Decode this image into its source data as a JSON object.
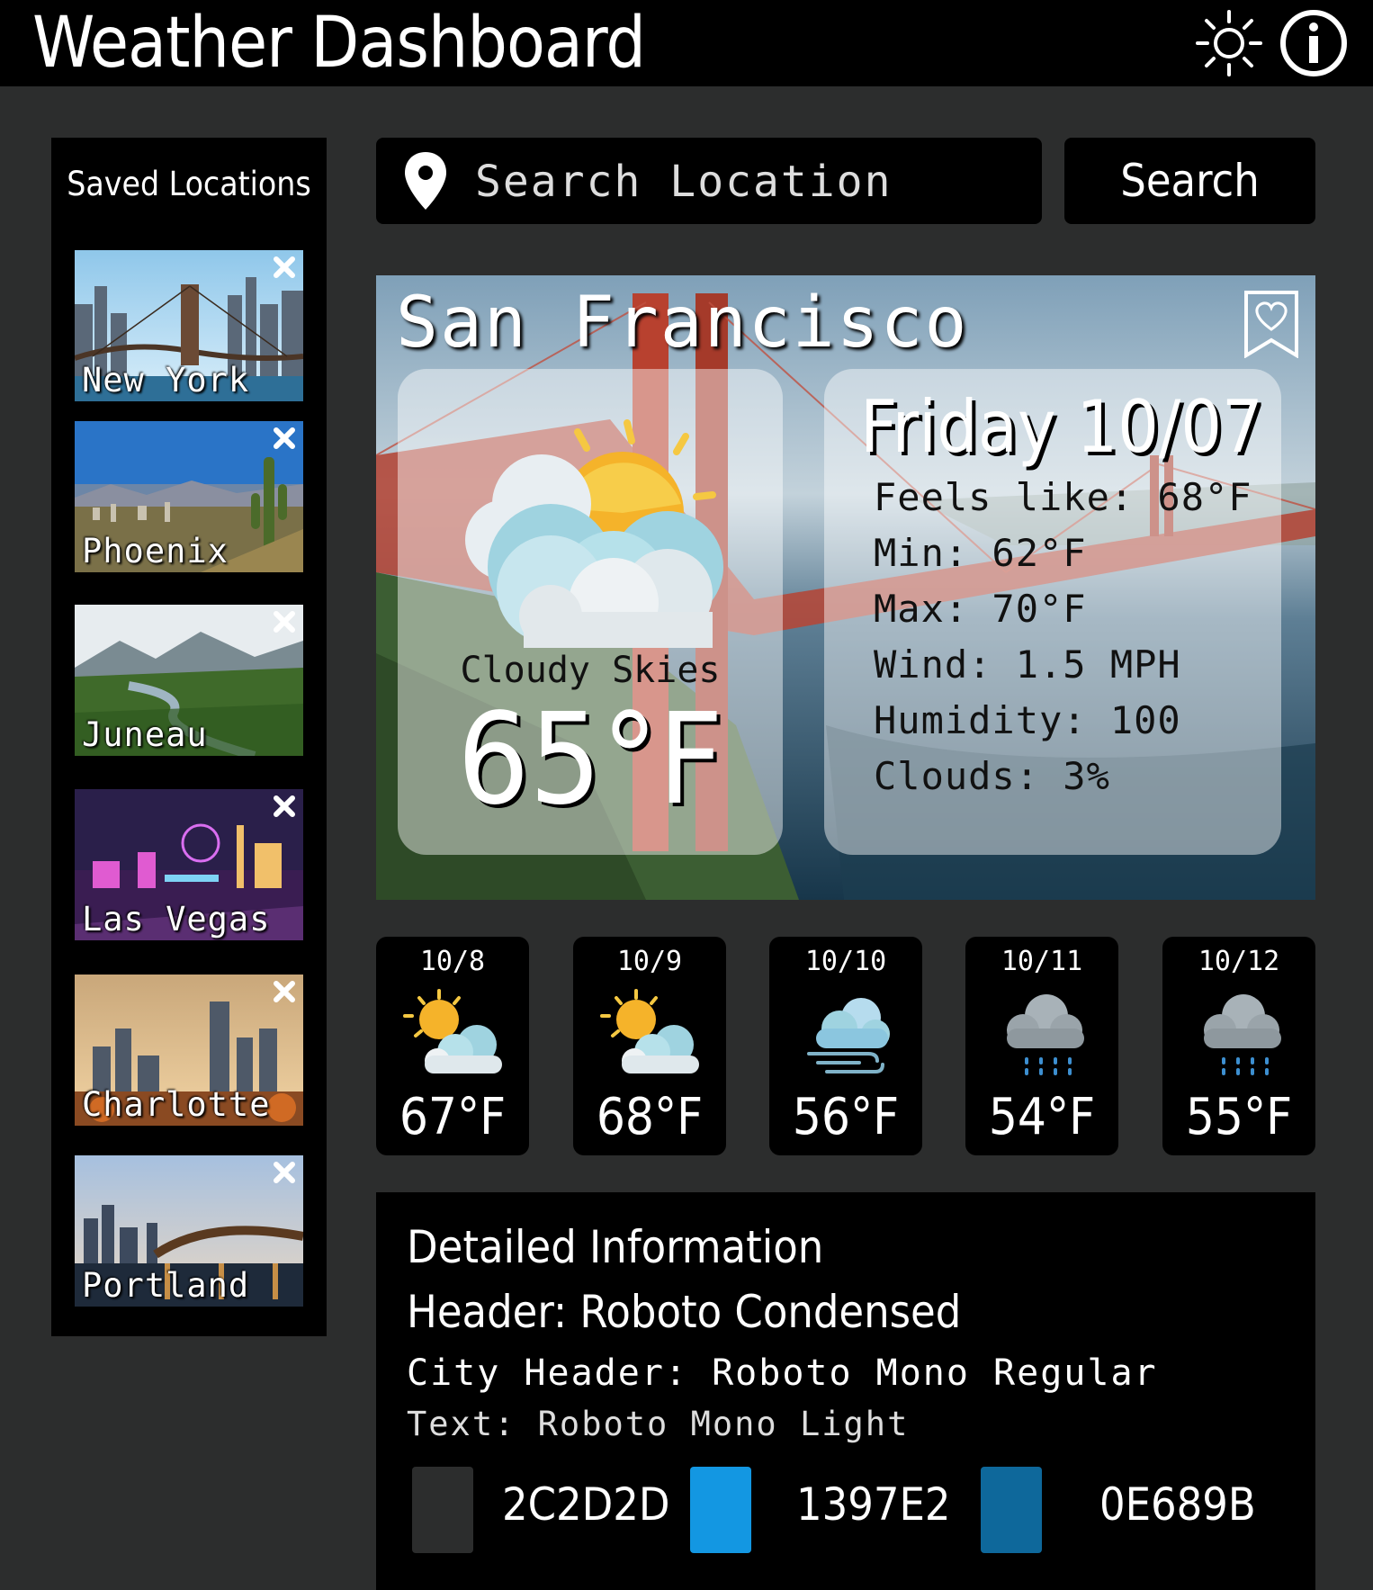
{
  "header": {
    "title": "Weather Dashboard",
    "theme_icon": "sun-icon",
    "info_icon": "info-icon"
  },
  "sidebar": {
    "title": "Saved Locations",
    "items": [
      {
        "label": "New York"
      },
      {
        "label": "Phoenix"
      },
      {
        "label": "Juneau"
      },
      {
        "label": "Las Vegas"
      },
      {
        "label": "Charlotte"
      },
      {
        "label": "Portland"
      }
    ]
  },
  "search": {
    "placeholder": "Search Location",
    "button_label": "Search"
  },
  "current": {
    "city": "San Francisco",
    "condition": "Cloudy Skies",
    "temp": "65°F",
    "date": "Friday 10/07",
    "feels_like": "Feels like: 68°F",
    "min": "Min: 62°F",
    "max": "Max: 70°F",
    "wind": "Wind: 1.5 MPH",
    "humidity": "Humidity: 100",
    "clouds": "Clouds: 3%"
  },
  "forecast": [
    {
      "date": "10/8",
      "temp": "67°F",
      "icon": "partly-cloudy-icon"
    },
    {
      "date": "10/9",
      "temp": "68°F",
      "icon": "partly-cloudy-icon"
    },
    {
      "date": "10/10",
      "temp": "56°F",
      "icon": "windy-cloud-icon"
    },
    {
      "date": "10/11",
      "temp": "54°F",
      "icon": "rain-cloud-icon"
    },
    {
      "date": "10/12",
      "temp": "55°F",
      "icon": "rain-cloud-icon"
    }
  ],
  "details": {
    "title": "Detailed Information",
    "header_font": "Header: Roboto Condensed",
    "city_header_font": "City Header: Roboto Mono Regular",
    "text_font": "Text: Roboto Mono Light",
    "colors": [
      {
        "hex": "2C2D2D",
        "value": "#2C2D2D"
      },
      {
        "hex": "1397E2",
        "value": "#1397E2"
      },
      {
        "hex": "0E689B",
        "value": "#0E689B"
      }
    ]
  }
}
